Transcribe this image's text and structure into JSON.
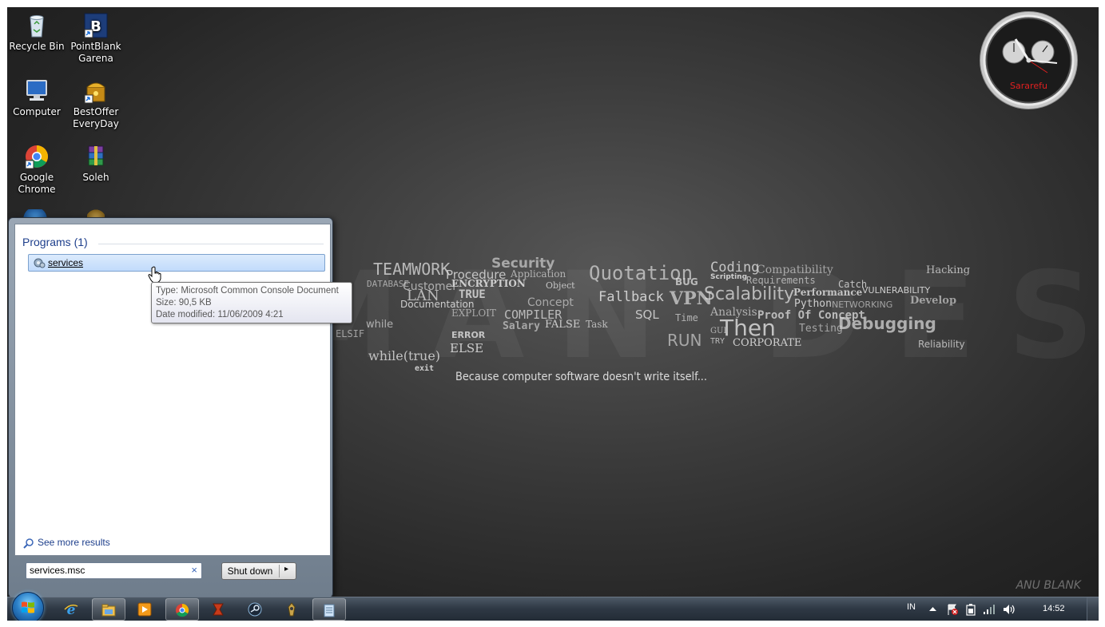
{
  "desktop": {
    "icons": [
      {
        "label": "Recycle Bin",
        "icon": "recycle-bin-icon"
      },
      {
        "label": "PointBlank Garena",
        "icon": "pointblank-icon"
      },
      {
        "label": "Computer",
        "icon": "computer-icon"
      },
      {
        "label": "BestOffer EveryDay",
        "icon": "bestoffer-icon"
      },
      {
        "label": "Google Chrome",
        "icon": "chrome-icon"
      },
      {
        "label": "Soleh",
        "icon": "winrar-archive-icon"
      }
    ]
  },
  "clock_gadget": {
    "name": "Sararefu"
  },
  "wallpaper": {
    "tagline": "Because computer software doesn't write itself...",
    "watermark": "DEMAN DESIGN",
    "cloud_words": [
      "Security",
      "Application",
      "TEAMWORK",
      "Procedure",
      "ENCRYPTION",
      "DATABASE",
      "Customer",
      "LAN",
      "TRUE",
      "Documentation",
      "EXPLOIT",
      "Quotation",
      "BUG",
      "Object",
      "Fallback",
      "Concept",
      "VPN",
      "COMPILER",
      "SQL",
      "FALSE",
      "Salary",
      "while",
      "Task",
      "Coding",
      "Scripting",
      "Compatibility",
      "Requirements",
      "Scalability",
      "Performance",
      "Python",
      "NETWORKING",
      "Analysis",
      "Proof Of Concept",
      "Then",
      "CORPORATE",
      "Testing",
      "Debugging",
      "Hacking",
      "Catch",
      "VULNERABILITY",
      "Develop",
      "Time",
      "Reliability",
      "while(true)",
      "exit",
      "RUN",
      "GUI",
      "TRY",
      "ERROR",
      "ELSE",
      "ELSIF"
    ],
    "signature": "ANU BLANK"
  },
  "start_menu": {
    "programs_heading": "Programs (1)",
    "result_label": "services",
    "see_more": "See more results",
    "search_value": "services.msc",
    "search_clear": "×",
    "shutdown_label": "Shut down",
    "shutdown_arrow": "▸"
  },
  "tooltip": {
    "type": "Type: Microsoft Common Console Document",
    "size": "Size: 90,5 KB",
    "date": "Date modified: 11/06/2009 4:21"
  },
  "taskbar": {
    "pinned": [
      {
        "icon": "internet-explorer-icon",
        "active": false
      },
      {
        "icon": "file-explorer-icon",
        "active": true
      },
      {
        "icon": "media-player-icon",
        "active": false
      },
      {
        "icon": "chrome-icon",
        "active": true
      },
      {
        "icon": "pointblank-icon",
        "active": false
      },
      {
        "icon": "steam-icon",
        "active": false
      },
      {
        "icon": "game-launcher-icon",
        "active": false
      },
      {
        "icon": "notepad-icon",
        "active": true
      }
    ],
    "language": "IN",
    "time": "14:52"
  },
  "colors": {
    "start_menu_link": "#1e3f8c",
    "clock_name": "#e02020",
    "selection": "#c1dbfc"
  }
}
